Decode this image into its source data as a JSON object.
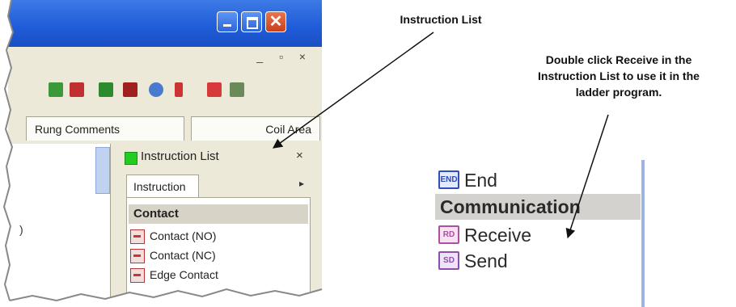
{
  "window": {
    "close_glyph": "✕",
    "mdi_controls": "_ ▫ ×"
  },
  "tabs": {
    "rung_comments": "Rung Comments",
    "coil_area": "Coil Area"
  },
  "editor": {
    "text": ")"
  },
  "instruction_panel": {
    "title": "Instruction List",
    "close": "×",
    "tab_label": "Instruction",
    "tab_more": "▸",
    "category": "Contact",
    "items": [
      {
        "label": "Contact (NO)"
      },
      {
        "label": "Contact (NC)"
      },
      {
        "label": "Edge Contact"
      }
    ]
  },
  "zoom": {
    "items": [
      {
        "badge": "END",
        "label": "End",
        "color": "#2d4fb6"
      },
      {
        "badge": "RD",
        "label": "Receive",
        "color": "#b04fa0"
      },
      {
        "badge": "SD",
        "label": "Send",
        "color": "#8b4fb0"
      }
    ],
    "category": "Communication"
  },
  "callouts": {
    "instruction_list": "Instruction List",
    "double_click_line1": "Double click Receive in the",
    "double_click_line2": "Instruction List to use it in the",
    "double_click_line3": "ladder program."
  },
  "colors": {
    "titlebar": "#1f5bd8",
    "status_green": "#22cc22",
    "close_red": "#c8401c"
  }
}
